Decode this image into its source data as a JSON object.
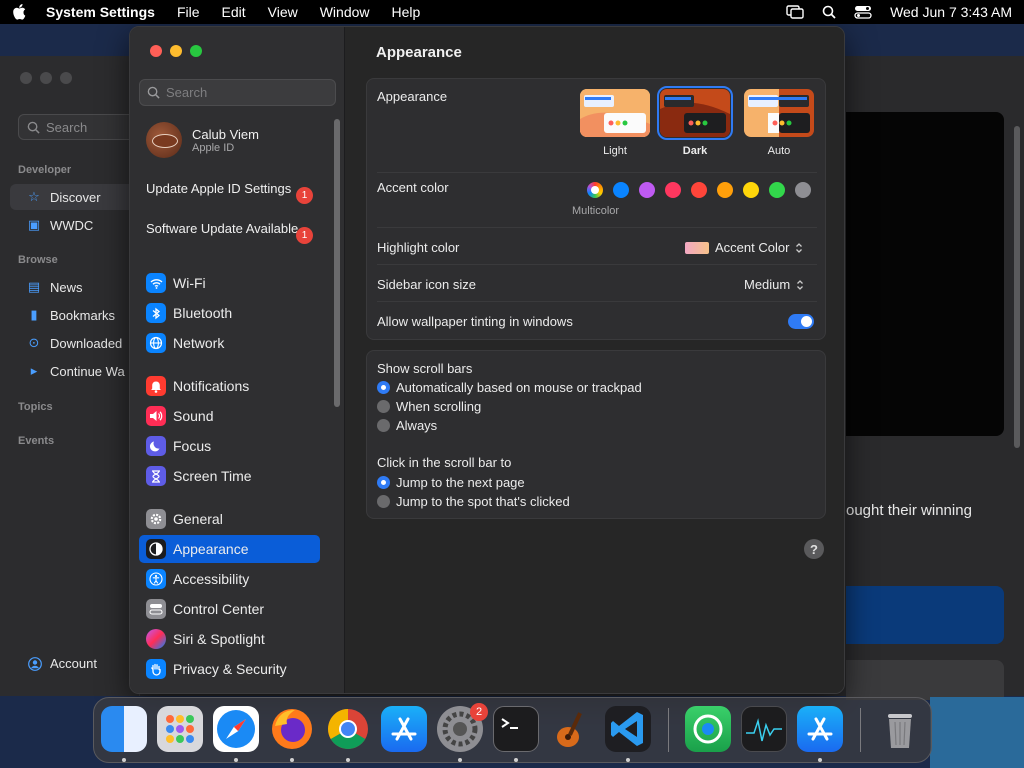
{
  "menubar": {
    "app_name": "System Settings",
    "items": [
      "File",
      "Edit",
      "View",
      "Window",
      "Help"
    ],
    "clock": "Wed Jun 7  3:43 AM"
  },
  "background_app": {
    "search_placeholder": "Search",
    "sections": {
      "developer": "Developer",
      "browse": "Browse",
      "topics": "Topics",
      "events": "Events"
    },
    "items": [
      {
        "label": "Discover",
        "icon": "star-icon",
        "active": true
      },
      {
        "label": "WWDC",
        "icon": "wwdc-icon",
        "active": false
      },
      {
        "label": "News",
        "icon": "news-icon",
        "active": false
      },
      {
        "label": "Bookmarks",
        "icon": "bookmark-icon",
        "active": false
      },
      {
        "label": "Downloaded",
        "icon": "download-icon",
        "active": false
      },
      {
        "label": "Continue Wa",
        "icon": "play-icon",
        "active": false
      }
    ],
    "account": "Account",
    "partial_text": "ought their winning"
  },
  "settings": {
    "search_placeholder": "Search",
    "profile": {
      "name": "Calub Viem",
      "subtitle": "Apple ID"
    },
    "notices": [
      {
        "label": "Update Apple ID Settings",
        "badge": "1"
      },
      {
        "label": "Software Update Available",
        "badge": "1"
      }
    ],
    "sidebar_items": [
      {
        "label": "Wi-Fi",
        "icon": "wifi-icon",
        "color": "#0a84ff"
      },
      {
        "label": "Bluetooth",
        "icon": "bluetooth-icon",
        "color": "#0a84ff"
      },
      {
        "label": "Network",
        "icon": "globe-icon",
        "color": "#0a84ff"
      },
      {
        "label": "Notifications",
        "icon": "bell-icon",
        "color": "#ff3b30"
      },
      {
        "label": "Sound",
        "icon": "speaker-icon",
        "color": "#ff2d55"
      },
      {
        "label": "Focus",
        "icon": "moon-icon",
        "color": "#5e5ce6"
      },
      {
        "label": "Screen Time",
        "icon": "hourglass-icon",
        "color": "#5e5ce6"
      },
      {
        "label": "General",
        "icon": "gear-icon",
        "color": "#8e8e93"
      },
      {
        "label": "Appearance",
        "icon": "appearance-icon",
        "color": "#1c1c1e"
      },
      {
        "label": "Accessibility",
        "icon": "accessibility-icon",
        "color": "#0a84ff"
      },
      {
        "label": "Control Center",
        "icon": "control-center-icon",
        "color": "#8e8e93"
      },
      {
        "label": "Siri & Spotlight",
        "icon": "siri-icon",
        "color": "#bf5af2"
      },
      {
        "label": "Privacy & Security",
        "icon": "hand-icon",
        "color": "#0a84ff"
      }
    ],
    "selected": "Appearance",
    "content": {
      "title": "Appearance",
      "appearance": {
        "label": "Appearance",
        "options": [
          "Light",
          "Dark",
          "Auto"
        ],
        "selected": "Dark"
      },
      "accent": {
        "label": "Accent color",
        "colors": [
          "multicolor",
          "#0a84ff",
          "#bf5af2",
          "#ff375f",
          "#ff453a",
          "#ff9f0a",
          "#ffd60a",
          "#32d74b",
          "#8e8e93"
        ],
        "selected_label": "Multicolor"
      },
      "highlight": {
        "label": "Highlight color",
        "value": "Accent Color"
      },
      "icon_size": {
        "label": "Sidebar icon size",
        "value": "Medium"
      },
      "tinting": {
        "label": "Allow wallpaper tinting in windows",
        "enabled": true
      },
      "scroll_bars": {
        "label": "Show scroll bars",
        "options": [
          "Automatically based on mouse or trackpad",
          "When scrolling",
          "Always"
        ],
        "selected": 0
      },
      "click_scroll": {
        "label": "Click in the scroll bar to",
        "options": [
          "Jump to the next page",
          "Jump to the spot that's clicked"
        ],
        "selected": 0
      },
      "help": "?"
    }
  },
  "dock": {
    "apps": [
      "Finder",
      "Launchpad",
      "Safari",
      "Firefox",
      "Chrome",
      "App Store",
      "System Settings",
      "Terminal",
      "GarageBand",
      "VS Code",
      "Find My",
      "Activity Monitor",
      "App Store",
      "Trash"
    ],
    "settings_badge": "2"
  }
}
